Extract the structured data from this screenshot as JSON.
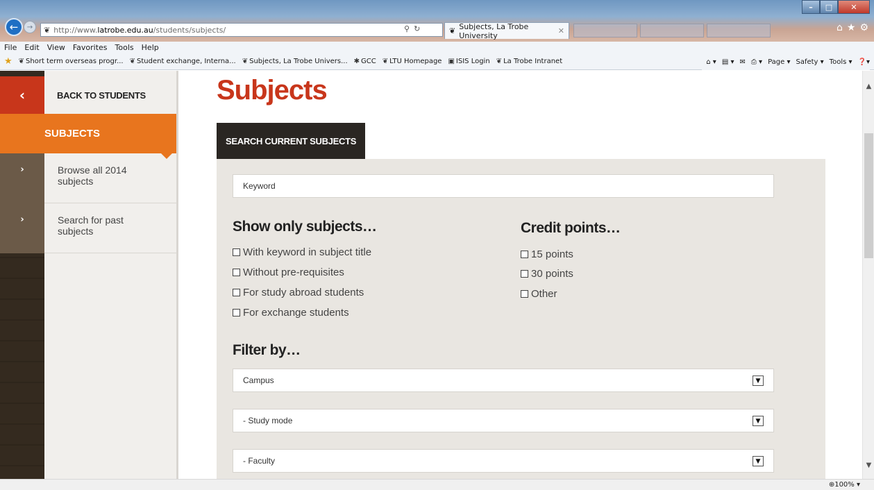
{
  "browser": {
    "url_prefix": "http://www.",
    "url_host": "latrobe.edu.au",
    "url_path": "/students/subjects/",
    "active_tab": "Subjects, La Trobe University",
    "menu": [
      "File",
      "Edit",
      "View",
      "Favorites",
      "Tools",
      "Help"
    ],
    "favorites": [
      "Short term overseas progr...",
      "Student exchange, Interna...",
      "Subjects, La Trobe Univers...",
      "GCC",
      "LTU Homepage",
      "ISIS Login",
      "La Trobe Intranet"
    ],
    "commands": [
      "Page ▾",
      "Safety ▾",
      "Tools ▾"
    ],
    "zoom": "100%"
  },
  "sidebar": {
    "back_label": "BACK TO STUDENTS",
    "current_label": "SUBJECTS",
    "items": [
      {
        "label": "Browse all 2014 subjects"
      },
      {
        "label": "Search for past subjects"
      }
    ]
  },
  "main": {
    "title": "Subjects",
    "search_tab": "SEARCH CURRENT SUBJECTS",
    "keyword_placeholder": "Keyword",
    "show_only": {
      "heading": "Show only subjects…",
      "options": [
        "With keyword in subject title",
        "Without pre-requisites",
        "For study abroad students",
        "For exchange students"
      ]
    },
    "credit_points": {
      "heading": "Credit points…",
      "options": [
        "15 points",
        "30 points",
        "Other"
      ]
    },
    "filter": {
      "heading": "Filter by…",
      "selects": [
        "Campus",
        "- Study mode",
        "- Faculty"
      ]
    }
  },
  "colors": {
    "accent_red": "#c8361b",
    "accent_orange": "#e8751e",
    "panel_bg": "#e9e6e1",
    "dark": "#2a2622"
  }
}
